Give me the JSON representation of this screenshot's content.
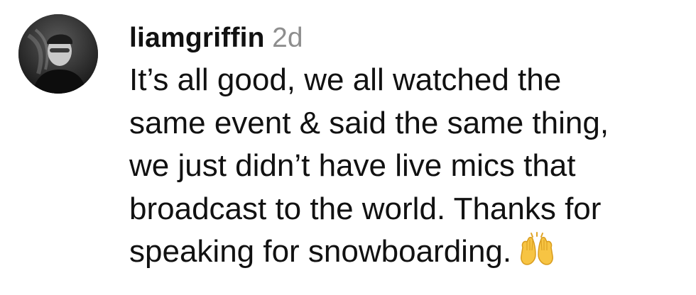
{
  "comment": {
    "username": "liamgriffin",
    "timestamp": "2d",
    "text_lines": [
      "It’s all good, we all watched the",
      "same event & said the same thing,",
      "we just didn’t have live mics that",
      "broadcast to the world. Thanks for",
      "speaking for snowboarding."
    ],
    "emoji": "raising-hands-icon"
  },
  "colors": {
    "username": "#111111",
    "timestamp": "#8e8e8e",
    "text": "#111111",
    "background": "#ffffff"
  }
}
